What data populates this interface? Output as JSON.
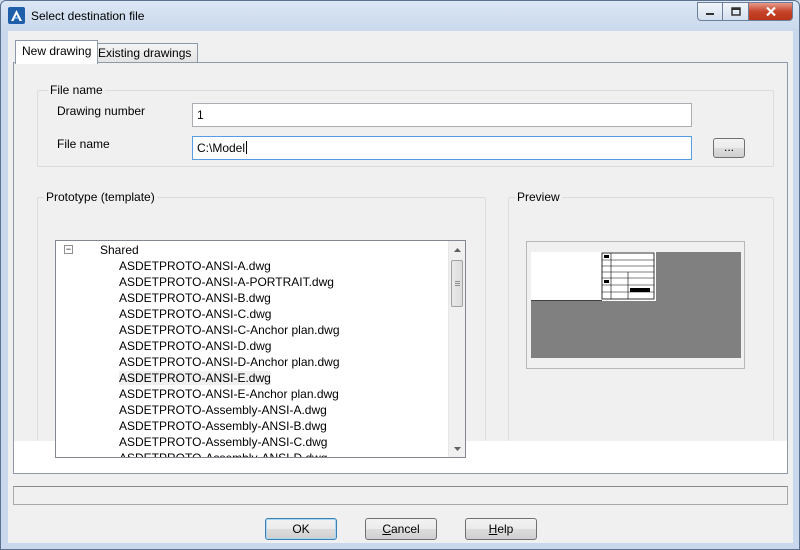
{
  "window": {
    "title": "Select destination file"
  },
  "tabs": [
    {
      "label": "New drawing",
      "active": true
    },
    {
      "label": "Existing drawings",
      "active": false
    }
  ],
  "file_name_group": {
    "label": "File name",
    "drawing_number_label": "Drawing number",
    "drawing_number_value": "1",
    "file_name_label": "File name",
    "file_name_value": "C:\\Model",
    "browse_label": "..."
  },
  "prototype_group": {
    "label": "Prototype (template)",
    "folder": "Shared",
    "items": [
      "ASDETPROTO-ANSI-A.dwg",
      "ASDETPROTO-ANSI-A-PORTRAIT.dwg",
      "ASDETPROTO-ANSI-B.dwg",
      "ASDETPROTO-ANSI-C.dwg",
      "ASDETPROTO-ANSI-C-Anchor plan.dwg",
      "ASDETPROTO-ANSI-D.dwg",
      "ASDETPROTO-ANSI-D-Anchor plan.dwg",
      "ASDETPROTO-ANSI-E.dwg",
      "ASDETPROTO-ANSI-E-Anchor plan.dwg",
      "ASDETPROTO-Assembly-ANSI-A.dwg",
      "ASDETPROTO-Assembly-ANSI-B.dwg",
      "ASDETPROTO-Assembly-ANSI-C.dwg",
      "ASDETPROTO-Assembly-ANSI-D.dwg"
    ],
    "selected_index": 7
  },
  "preview_group": {
    "label": "Preview"
  },
  "buttons": {
    "ok": "OK",
    "cancel_first": "C",
    "cancel_rest": "ancel",
    "help_first": "H",
    "help_rest": "elp"
  },
  "colors": {
    "accent": "#3c7fb1",
    "close_button": "#c7442b",
    "preview_background": "#808080"
  }
}
